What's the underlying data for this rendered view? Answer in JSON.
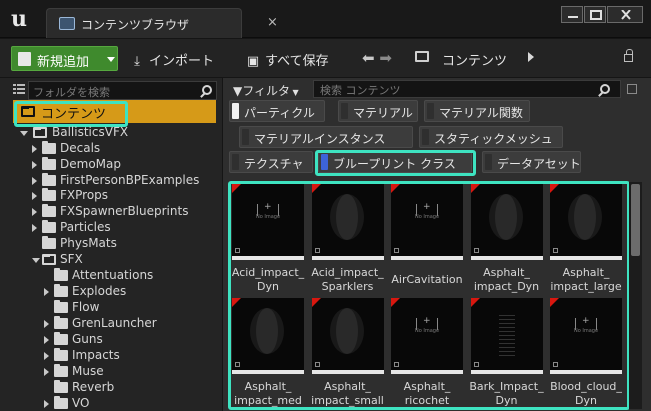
{
  "window": {
    "tab_title": "コンテンツブラウザ",
    "close_glyph": "×"
  },
  "toolbar": {
    "add_new_label": "新規追加",
    "import_label": "インポート",
    "save_all_label": "すべて保存",
    "path_label": "コンテンツ"
  },
  "folders": {
    "search_placeholder": "フォルダを検索",
    "root_label": "コンテンツ",
    "project_label": "BallisticsVFX",
    "items": [
      {
        "label": "Decals",
        "expandable": true
      },
      {
        "label": "DemoMap",
        "expandable": true
      },
      {
        "label": "FirstPersonBPExamples",
        "expandable": true
      },
      {
        "label": "FXProps",
        "expandable": true
      },
      {
        "label": "FXSpawnerBlueprints",
        "expandable": true
      },
      {
        "label": "Particles",
        "expandable": true
      },
      {
        "label": "PhysMats",
        "expandable": false
      },
      {
        "label": "SFX",
        "expandable": true,
        "expanded": true
      }
    ],
    "sfx_children": [
      {
        "label": "Attentuations",
        "expandable": false
      },
      {
        "label": "Explodes",
        "expandable": true
      },
      {
        "label": "Flow",
        "expandable": false
      },
      {
        "label": "GrenLauncher",
        "expandable": true
      },
      {
        "label": "Guns",
        "expandable": true
      },
      {
        "label": "Impacts",
        "expandable": true
      },
      {
        "label": "Muse",
        "expandable": true
      },
      {
        "label": "Reverb",
        "expandable": false
      },
      {
        "label": "VO",
        "expandable": true
      }
    ]
  },
  "content": {
    "filter_label": "フィルタ",
    "search_placeholder": "検索 コンテンツ",
    "filter_chips": [
      {
        "label": "パーティクル",
        "color": "#f2f2f2"
      },
      {
        "label": "マテリアル",
        "color": "#2f2f2f"
      },
      {
        "label": "マテリアル関数",
        "color": "#2f2f2f"
      },
      {
        "label": "マテリアルインスタンス",
        "color": "#2f2f2f"
      },
      {
        "label": "スタティックメッシュ",
        "color": "#2f2f2f"
      },
      {
        "label": "テクスチャ",
        "color": "#2f2f2f"
      },
      {
        "label": "ブループリント クラス",
        "color": "#3d63d8"
      },
      {
        "label": "データアセット",
        "color": "#2f2f2f"
      }
    ],
    "assets": [
      {
        "name": "Acid_impact_\nDyn",
        "thumb": "noimage"
      },
      {
        "name": "Acid_impact_\nSparklers",
        "thumb": "smoke"
      },
      {
        "name": "AirCavitation",
        "thumb": "noimage"
      },
      {
        "name": "Asphalt_\nimpact_Dyn",
        "thumb": "dust"
      },
      {
        "name": "Asphalt_\nimpact_large",
        "thumb": "dust"
      },
      {
        "name": "Asphalt_\nimpact_med",
        "thumb": "dust"
      },
      {
        "name": "Asphalt_\nimpact_small",
        "thumb": "dust"
      },
      {
        "name": "Asphalt_\nricochet",
        "thumb": "cross"
      },
      {
        "name": "Bark_Impact_\nDyn",
        "thumb": "dots"
      },
      {
        "name": "Blood_cloud_\nDyn",
        "thumb": "cross"
      }
    ],
    "no_image_text": "No Image"
  }
}
